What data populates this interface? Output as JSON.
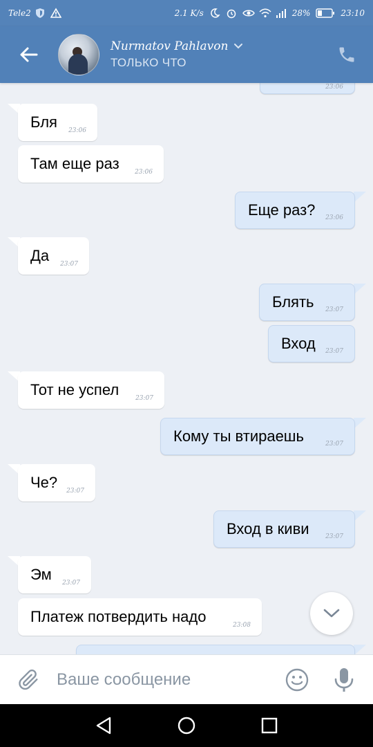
{
  "status_bar": {
    "carrier": "Tele2",
    "speed": "2.1 K/s",
    "battery": "28%",
    "time": "23:10"
  },
  "header": {
    "contact_name": "Nurmatov Pahlavon",
    "contact_status": "ТОЛЬКО ЧТО"
  },
  "messages": [
    {
      "dir": "out",
      "text": "",
      "time": "23:06"
    },
    {
      "dir": "in",
      "text": "Бля",
      "time": "23:06"
    },
    {
      "dir": "in",
      "text": "Там еще раз",
      "time": "23:06"
    },
    {
      "dir": "out",
      "text": "Еще раз?",
      "time": "23:06"
    },
    {
      "dir": "in",
      "text": "Да",
      "time": "23:07"
    },
    {
      "dir": "out",
      "text": "Блять",
      "time": "23:07"
    },
    {
      "dir": "out",
      "text": "Вход",
      "time": "23:07"
    },
    {
      "dir": "in",
      "text": "Тот не успел",
      "time": "23:07"
    },
    {
      "dir": "out",
      "text": "Кому ты втираешь",
      "time": "23:07"
    },
    {
      "dir": "in",
      "text": "Че?",
      "time": "23:07"
    },
    {
      "dir": "out",
      "text": "Вход в киви",
      "time": "23:07"
    },
    {
      "dir": "in",
      "text": "Эм",
      "time": "23:07"
    },
    {
      "dir": "in",
      "text": "Платеж потвердить надо",
      "time": "23:08"
    }
  ],
  "composer": {
    "placeholder": "Ваше сообщение"
  },
  "icons": {
    "back": "arrow-left-icon",
    "call": "phone-icon",
    "attach": "paperclip-icon",
    "emoji": "smiley-icon",
    "mic": "microphone-icon",
    "scroll_down": "chevron-down-icon"
  },
  "colors": {
    "header": "#5181b8",
    "incoming_bubble": "#ffffff",
    "outgoing_bubble": "#dce9f9",
    "chat_background": "#edf0f5"
  }
}
